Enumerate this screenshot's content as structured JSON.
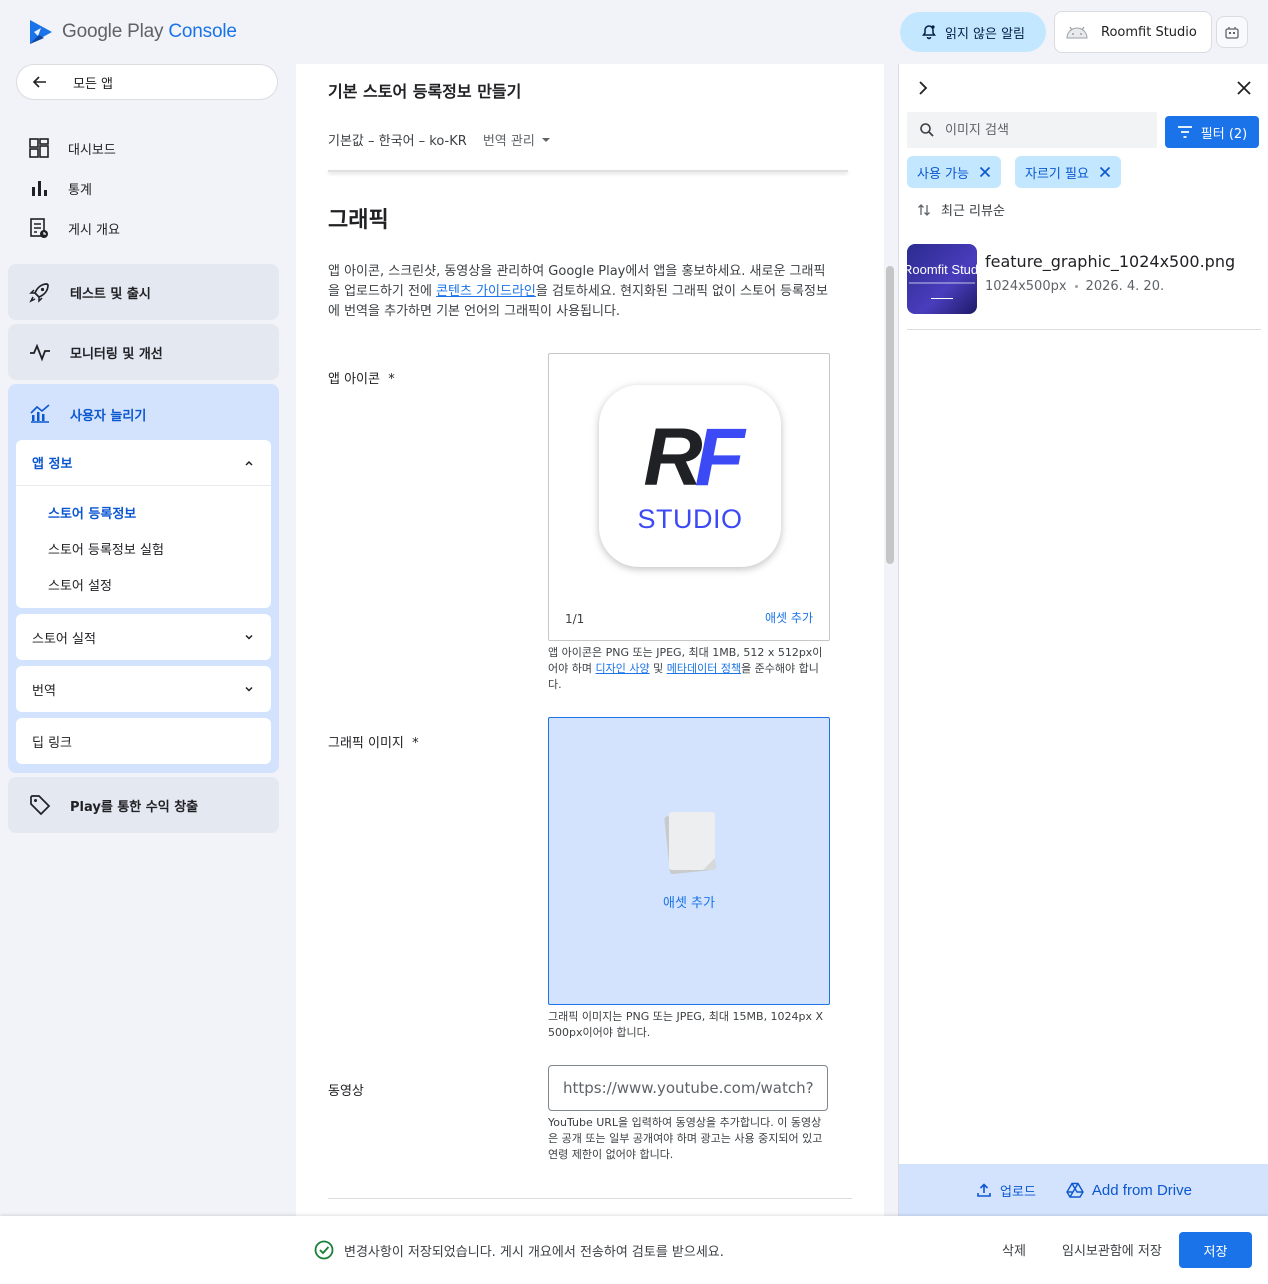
{
  "header": {
    "logo_text_a": "Google Play ",
    "logo_text_b": "Console",
    "notify_label": "읽지 않은 알림",
    "account_name": "Roomfit Studio"
  },
  "sidebar": {
    "all_apps": "모든 앱",
    "dashboard": "대시보드",
    "stats": "통계",
    "publish_overview": "게시 개요",
    "test_release": "테스트 및 출시",
    "monitor": "모니터링 및 개선",
    "grow": "사용자 늘리기",
    "app_info": {
      "title": "앱 정보",
      "items": [
        "스토어 등록정보",
        "스토어 등록정보 실험",
        "스토어 설정"
      ]
    },
    "store_performance": "스토어 실적",
    "translation": "번역",
    "deep_link": "딥 링크",
    "monetize": "Play를 통한 수익 창출"
  },
  "main": {
    "title": "기본 스토어 등록정보 만들기",
    "locale": "기본값 – 한국어 – ko-KR",
    "translation_manage": "번역 관리",
    "section_title": "그래픽",
    "desc_before": "앱 아이콘, 스크린샷, 동영상을 관리하여 Google Play에서 앱을 홍보하세요. 새로운 그래픽을 업로드하기 전에 ",
    "desc_link": "콘텐츠 가이드라인",
    "desc_after": "을 검토하세요. 현지화된 그래픽 없이 스토어 등록정보에 번역을 추가하면 기본 언어의 그래픽이 사용됩니다.",
    "app_icon": {
      "label": "앱 아이콘",
      "required": "*",
      "icon_r": "R",
      "icon_f": "F",
      "icon_studio": "STUDIO",
      "count": "1/1",
      "add": "애셋 추가",
      "help_before": "앱 아이콘은 PNG 또는 JPEG, 최대 1MB, 512 x 512px이어야 하며 ",
      "help_link1": "디자인 사양",
      "help_mid": " 및 ",
      "help_link2": "메타데이터 정책",
      "help_after": "을 준수해야 합니다."
    },
    "graphic": {
      "label": "그래픽 이미지",
      "required": "*",
      "add": "애셋 추가",
      "help": "그래픽 이미지는 PNG 또는 JPEG, 최대 15MB, 1024px X 500px이어야 합니다."
    },
    "video": {
      "label": "동영상",
      "placeholder": "https://www.youtube.com/watch?...",
      "help": "YouTube URL을 입력하여 동영상을 추가합니다. 이 동영상은 공개 또는 일부 공개여야 하며 광고는 사용 중지되어 있고 연령 제한이 없어야 합니다."
    }
  },
  "panel": {
    "search_placeholder": "이미지 검색",
    "filter_label": "필터 (2)",
    "chips": [
      "사용 가능",
      "자르기 필요"
    ],
    "sort_label": "최근 리뷰순",
    "asset": {
      "thumb_text": "Roomfit Studio",
      "name": "feature_graphic_1024x500.png",
      "size": "1024x500px",
      "date": "2026. 4. 20."
    },
    "upload": "업로드",
    "drive": "Add from Drive"
  },
  "bottom": {
    "message": "변경사항이 저장되었습니다. 게시 개요에서 전송하여 검토를 받으세요.",
    "delete": "삭제",
    "draft": "임시보관함에 저장",
    "save": "저장"
  }
}
